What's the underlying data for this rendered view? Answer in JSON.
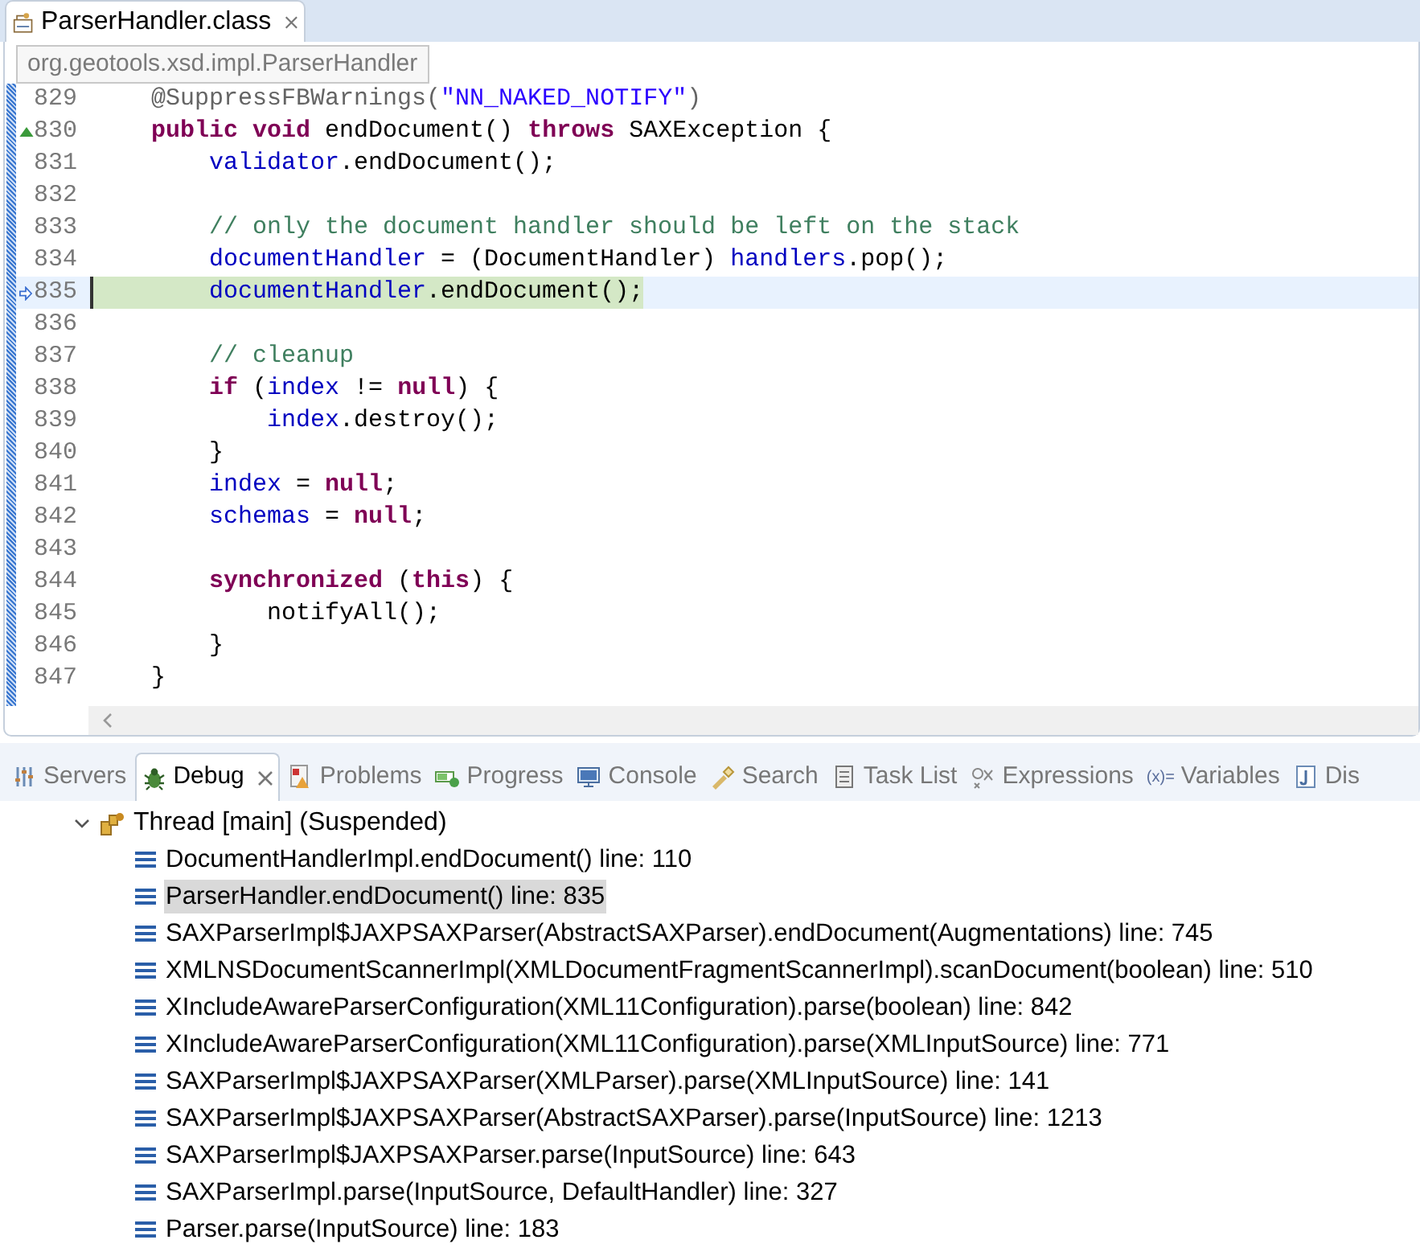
{
  "editor_tab": {
    "label": "ParserHandler.class",
    "selected": true
  },
  "tooltip": "org.geotools.xsd.impl.ParserHandler",
  "code_lines": [
    {
      "number": "829",
      "current": false,
      "override_marker": false,
      "pointer_marker": false,
      "tokens": [
        {
          "kind": "annotation",
          "text": "    @SuppressFBWarnings("
        },
        {
          "kind": "string",
          "text": "\"NN_NAKED_NOTIFY\""
        },
        {
          "kind": "annotation",
          "text": ")"
        }
      ]
    },
    {
      "number": "830",
      "current": false,
      "override_marker": true,
      "pointer_marker": false,
      "tokens": [
        {
          "kind": "keyword",
          "text": "    public void"
        },
        {
          "kind": "plain",
          "text": " endDocument() "
        },
        {
          "kind": "keyword",
          "text": "throws"
        },
        {
          "kind": "plain",
          "text": " SAXException {"
        }
      ]
    },
    {
      "number": "831",
      "current": false,
      "override_marker": false,
      "pointer_marker": false,
      "tokens": [
        {
          "kind": "field",
          "text": "        validator"
        },
        {
          "kind": "plain",
          "text": ".endDocument();"
        }
      ]
    },
    {
      "number": "832",
      "current": false,
      "override_marker": false,
      "pointer_marker": false
    },
    {
      "number": "833",
      "current": false,
      "override_marker": false,
      "pointer_marker": false,
      "tokens": [
        {
          "kind": "comment",
          "text": "        // only the document handler should be left on the stack"
        }
      ]
    },
    {
      "number": "834",
      "current": false,
      "override_marker": false,
      "pointer_marker": false,
      "tokens": [
        {
          "kind": "field",
          "text": "        documentHandler"
        },
        {
          "kind": "plain",
          "text": " = (DocumentHandler) "
        },
        {
          "kind": "field",
          "text": "handlers"
        },
        {
          "kind": "plain",
          "text": ".pop();"
        }
      ]
    },
    {
      "number": "835",
      "current": true,
      "override_marker": false,
      "pointer_marker": true,
      "tokens": [
        {
          "kind": "field",
          "text": "        documentHandler"
        },
        {
          "kind": "plain",
          "text": ".endDocument();"
        }
      ]
    },
    {
      "number": "836",
      "current": false,
      "override_marker": false,
      "pointer_marker": false
    },
    {
      "number": "837",
      "current": false,
      "override_marker": false,
      "pointer_marker": false,
      "tokens": [
        {
          "kind": "comment",
          "text": "        // cleanup"
        }
      ]
    },
    {
      "number": "838",
      "current": false,
      "override_marker": false,
      "pointer_marker": false,
      "tokens": [
        {
          "kind": "keyword",
          "text": "        if"
        },
        {
          "kind": "plain",
          "text": " ("
        },
        {
          "kind": "field",
          "text": "index"
        },
        {
          "kind": "plain",
          "text": " != "
        },
        {
          "kind": "keyword",
          "text": "null"
        },
        {
          "kind": "plain",
          "text": ") {"
        }
      ]
    },
    {
      "number": "839",
      "current": false,
      "override_marker": false,
      "pointer_marker": false,
      "tokens": [
        {
          "kind": "field",
          "text": "            index"
        },
        {
          "kind": "plain",
          "text": ".destroy();"
        }
      ]
    },
    {
      "number": "840",
      "current": false,
      "override_marker": false,
      "pointer_marker": false,
      "tokens": [
        {
          "kind": "plain",
          "text": "        }"
        }
      ]
    },
    {
      "number": "841",
      "current": false,
      "override_marker": false,
      "pointer_marker": false,
      "tokens": [
        {
          "kind": "field",
          "text": "        index"
        },
        {
          "kind": "plain",
          "text": " = "
        },
        {
          "kind": "keyword",
          "text": "null"
        },
        {
          "kind": "plain",
          "text": ";"
        }
      ]
    },
    {
      "number": "842",
      "current": false,
      "override_marker": false,
      "pointer_marker": false,
      "tokens": [
        {
          "kind": "field",
          "text": "        schemas"
        },
        {
          "kind": "plain",
          "text": " = "
        },
        {
          "kind": "keyword",
          "text": "null"
        },
        {
          "kind": "plain",
          "text": ";"
        }
      ]
    },
    {
      "number": "843",
      "current": false,
      "override_marker": false,
      "pointer_marker": false
    },
    {
      "number": "844",
      "current": false,
      "override_marker": false,
      "pointer_marker": false,
      "tokens": [
        {
          "kind": "keyword",
          "text": "        synchronized"
        },
        {
          "kind": "plain",
          "text": " ("
        },
        {
          "kind": "keyword",
          "text": "this"
        },
        {
          "kind": "plain",
          "text": ") {"
        }
      ]
    },
    {
      "number": "845",
      "current": false,
      "override_marker": false,
      "pointer_marker": false,
      "tokens": [
        {
          "kind": "plain",
          "text": "            notifyAll();"
        }
      ]
    },
    {
      "number": "846",
      "current": false,
      "override_marker": false,
      "pointer_marker": false,
      "tokens": [
        {
          "kind": "plain",
          "text": "        }"
        }
      ]
    },
    {
      "number": "847",
      "current": false,
      "override_marker": false,
      "pointer_marker": false,
      "tokens": [
        {
          "kind": "plain",
          "text": "    }"
        }
      ]
    }
  ],
  "view_tabs": [
    {
      "label": "Servers",
      "selected": false
    },
    {
      "label": "Debug",
      "selected": true
    },
    {
      "label": "Problems",
      "selected": false
    },
    {
      "label": "Progress",
      "selected": false
    },
    {
      "label": "Console",
      "selected": false
    },
    {
      "label": "Search",
      "selected": false
    },
    {
      "label": "Task List",
      "selected": false
    },
    {
      "label": "Expressions",
      "selected": false
    },
    {
      "label": "Variables",
      "selected": false,
      "icon_text": "(x)="
    },
    {
      "label": "Dis",
      "selected": false
    }
  ],
  "debug_tree": {
    "thread": {
      "label": "Thread [main] (Suspended)",
      "expanded": true,
      "frames": [
        {
          "label": "DocumentHandlerImpl.endDocument() line: 110",
          "selected": false
        },
        {
          "label": "ParserHandler.endDocument() line: 835",
          "selected": true
        },
        {
          "label": "SAXParserImpl$JAXPSAXParser(AbstractSAXParser).endDocument(Augmentations) line: 745",
          "selected": false
        },
        {
          "label": "XMLNSDocumentScannerImpl(XMLDocumentFragmentScannerImpl).scanDocument(boolean) line: 510",
          "selected": false
        },
        {
          "label": "XIncludeAwareParserConfiguration(XML11Configuration).parse(boolean) line: 842",
          "selected": false
        },
        {
          "label": "XIncludeAwareParserConfiguration(XML11Configuration).parse(XMLInputSource) line: 771",
          "selected": false
        },
        {
          "label": "SAXParserImpl$JAXPSAXParser(XMLParser).parse(XMLInputSource) line: 141",
          "selected": false
        },
        {
          "label": "SAXParserImpl$JAXPSAXParser(AbstractSAXParser).parse(InputSource) line: 1213",
          "selected": false
        },
        {
          "label": "SAXParserImpl$JAXPSAXParser.parse(InputSource) line: 643",
          "selected": false
        },
        {
          "label": "SAXParserImpl.parse(InputSource, DefaultHandler) line: 327",
          "selected": false
        },
        {
          "label": "Parser.parse(InputSource) line: 183",
          "selected": false
        }
      ]
    }
  }
}
